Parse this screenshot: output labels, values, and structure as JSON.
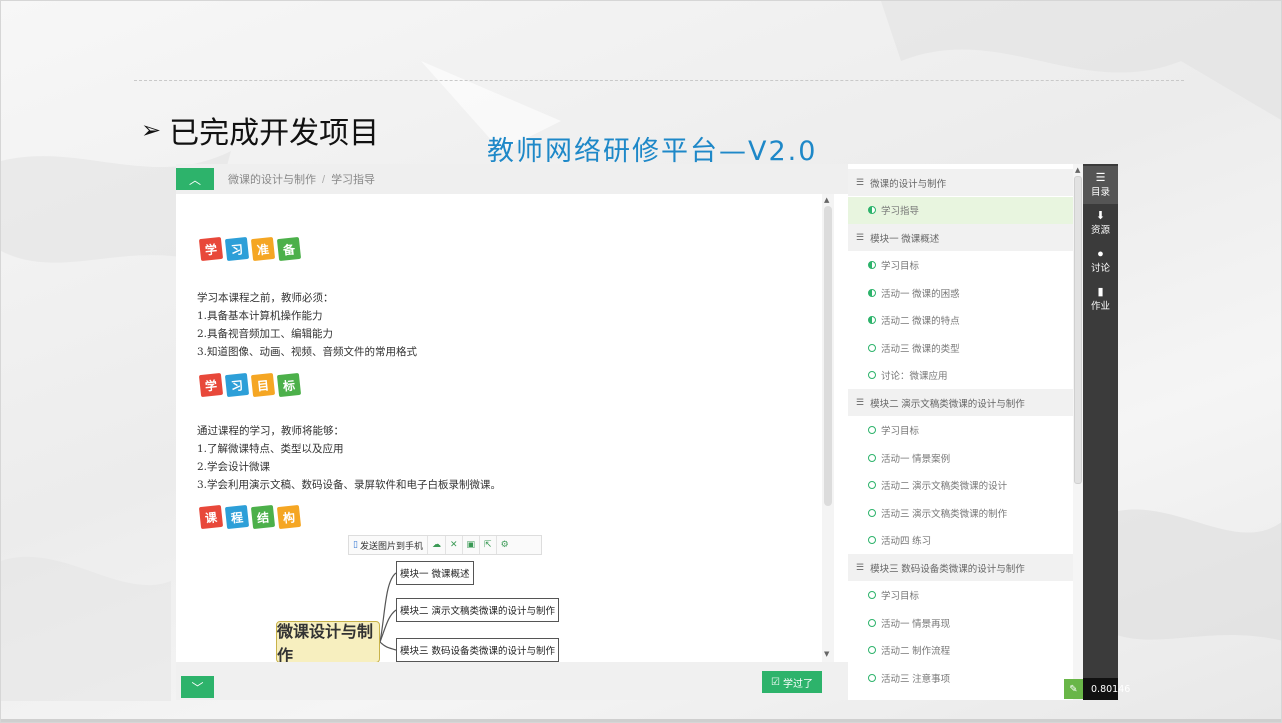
{
  "slide": {
    "heading": "已完成开发项目",
    "bullet_glyph": "➢",
    "platform_title": "教师网络研修平台—V2.0"
  },
  "app": {
    "breadcrumb": [
      "微课的设计与制作",
      "学习指导"
    ],
    "breadcrumb_sep": "/",
    "learned_button": "学过了",
    "sections": [
      {
        "badge_chars": [
          "学",
          "习",
          "准",
          "备"
        ],
        "lines": [
          "学习本课程之前，教师必须：",
          "1.具备基本计算机操作能力",
          "2.具备视音频加工、编辑能力",
          "3.知道图像、动画、视频、音频文件的常用格式"
        ]
      },
      {
        "badge_chars": [
          "学",
          "习",
          "目",
          "标"
        ],
        "lines": [
          "通过课程的学习，教师将能够：",
          "1.了解微课特点、类型以及应用",
          "2.学会设计微课",
          "3.学会利用演示文稿、数码设备、录屏软件和电子白板录制微课。"
        ]
      },
      {
        "badge_chars": [
          "课",
          "程",
          "结",
          "构"
        ],
        "lines": []
      }
    ],
    "mindmap": {
      "toolbar_send": "发送图片到手机",
      "center": "微课设计与制作",
      "nodes": [
        "模块一 微课概述",
        "模块二 演示文稿类微课的设计与制作",
        "模块三 数码设备类微课的设计与制作"
      ]
    },
    "toc": [
      {
        "type": "chapter",
        "label": "微课的设计与制作"
      },
      {
        "type": "item",
        "label": "学习指导",
        "status": "half",
        "active": true
      },
      {
        "type": "chapter",
        "label": "模块一 微课概述"
      },
      {
        "type": "item",
        "label": "学习目标",
        "status": "half"
      },
      {
        "type": "item",
        "label": "活动一 微课的困惑",
        "status": "half"
      },
      {
        "type": "item",
        "label": "活动二 微课的特点",
        "status": "half"
      },
      {
        "type": "item",
        "label": "活动三 微课的类型",
        "status": "empty"
      },
      {
        "type": "item",
        "label": "讨论：微课应用",
        "status": "empty"
      },
      {
        "type": "chapter",
        "label": "模块二 演示文稿类微课的设计与制作"
      },
      {
        "type": "item",
        "label": "学习目标",
        "status": "empty"
      },
      {
        "type": "item",
        "label": "活动一 情景案例",
        "status": "empty"
      },
      {
        "type": "item",
        "label": "活动二 演示文稿类微课的设计",
        "status": "empty"
      },
      {
        "type": "item",
        "label": "活动三 演示文稿类微课的制作",
        "status": "empty"
      },
      {
        "type": "item",
        "label": "活动四 练习",
        "status": "empty"
      },
      {
        "type": "chapter",
        "label": "模块三 数码设备类微课的设计与制作"
      },
      {
        "type": "item",
        "label": "学习目标",
        "status": "empty"
      },
      {
        "type": "item",
        "label": "活动一 情景再现",
        "status": "empty"
      },
      {
        "type": "item",
        "label": "活动二 制作流程",
        "status": "empty"
      },
      {
        "type": "item",
        "label": "活动三 注意事项",
        "status": "empty"
      }
    ],
    "sidebar": [
      {
        "label": "目录",
        "icon": "list-icon",
        "glyph": "☰",
        "active": true
      },
      {
        "label": "资源",
        "icon": "download-icon",
        "glyph": "⬇"
      },
      {
        "label": "讨论",
        "icon": "chat-icon",
        "glyph": "●"
      },
      {
        "label": "作业",
        "icon": "file-icon",
        "glyph": "▮"
      }
    ],
    "corner_value": "0.80146"
  },
  "colors": {
    "accent_green": "#2db36b",
    "title_blue": "#1e88c8",
    "badge_colors": [
      "#e8483a",
      "#2d9fd8",
      "#f5a623",
      "#4cb04a"
    ]
  }
}
